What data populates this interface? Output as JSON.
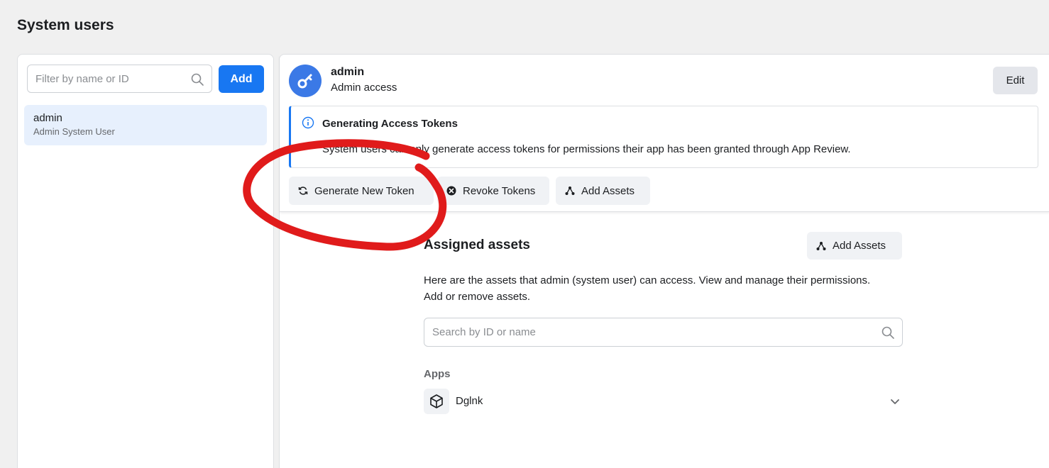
{
  "page": {
    "title": "System users"
  },
  "left_panel": {
    "filter_placeholder": "Filter by name or ID",
    "add_label": "Add",
    "users": [
      {
        "name": "admin",
        "subtitle": "Admin System User"
      }
    ]
  },
  "detail": {
    "name": "admin",
    "subtitle": "Admin access",
    "edit_label": "Edit",
    "info": {
      "title": "Generating Access Tokens",
      "text": "System users can only generate access tokens for permissions their app has been granted through App Review."
    },
    "actions": {
      "generate_label": "Generate New Token",
      "revoke_label": "Revoke Tokens",
      "add_assets_label": "Add Assets"
    }
  },
  "assets": {
    "title": "Assigned assets",
    "add_label": "Add Assets",
    "description_line1": "Here are the assets that admin (system user) can access. View and manage their permissions.",
    "description_line2": "Add or remove assets.",
    "search_placeholder": "Search by ID or name",
    "apps_label": "Apps",
    "apps": [
      {
        "name": "Dglnk"
      }
    ]
  },
  "colors": {
    "accent": "#1877f2",
    "avatar": "#3b79e6",
    "annotation": "#e01b1b"
  }
}
